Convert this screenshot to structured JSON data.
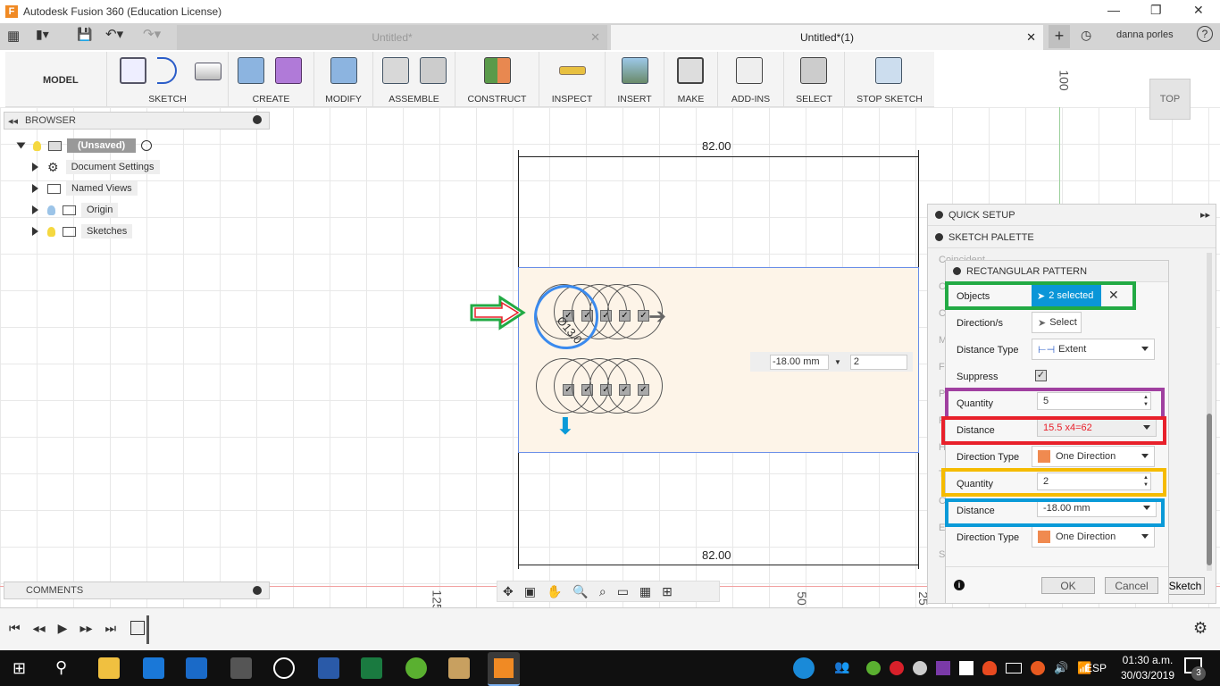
{
  "window": {
    "title": "Autodesk Fusion 360 (Education License)"
  },
  "tabs": [
    {
      "label": "Untitled*",
      "active": false
    },
    {
      "label": "Untitled*(1)",
      "active": true
    }
  ],
  "user": {
    "name": "danna porles"
  },
  "toolbar": {
    "workspace": "MODEL",
    "groups": [
      "SKETCH",
      "CREATE",
      "MODIFY",
      "ASSEMBLE",
      "CONSTRUCT",
      "INSPECT",
      "INSERT",
      "MAKE",
      "ADD-INS",
      "SELECT",
      "STOP SKETCH"
    ]
  },
  "browser": {
    "title": "BROWSER",
    "root": "(Unsaved)",
    "items": [
      "Document Settings",
      "Named Views",
      "Origin",
      "Sketches"
    ]
  },
  "comments": {
    "title": "COMMENTS"
  },
  "viewcube": {
    "label": "TOP"
  },
  "canvas": {
    "dim_top": "82.00",
    "dim_bottom": "82.00",
    "ruler_100": "100",
    "ruler_50": "50",
    "ruler_125": "125",
    "ruler_25": "25",
    "diameter": "Ø13.0",
    "inline_distance": "-18.00 mm",
    "inline_quantity": "2"
  },
  "palette": {
    "quick_setup": "QUICK SETUP",
    "sketch_palette": "SKETCH PALETTE",
    "faded": [
      "Coincident",
      "C",
      "C",
      "M",
      "Fi",
      "P",
      "P",
      "H",
      "T",
      "C",
      "Ec",
      "S"
    ],
    "title": "RECTANGULAR PATTERN",
    "objects_label": "Objects",
    "objects_value": "2 selected",
    "directions_label": "Direction/s",
    "directions_value": "Select",
    "distance_type_label": "Distance Type",
    "distance_type_value": "Extent",
    "suppress_label": "Suppress",
    "suppress_checked": true,
    "quantity1_label": "Quantity",
    "quantity1_value": "5",
    "distance1_label": "Distance",
    "distance1_value": "15.5 x4=62",
    "direction_type1_label": "Direction Type",
    "direction_type1_value": "One Direction",
    "quantity2_label": "Quantity",
    "quantity2_value": "2",
    "distance2_label": "Distance",
    "distance2_value": "-18.00 mm",
    "direction_type2_label": "Direction Type",
    "direction_type2_value": "One Direction",
    "ok": "OK",
    "cancel": "Cancel",
    "sketch": "Sketch"
  },
  "annotation_colors": {
    "objects": "#22aa44",
    "quantity1": "#a040a0",
    "distance1": "#e8202a",
    "quantity2": "#f5bb00",
    "distance2": "#0a9ad8"
  },
  "taskbar": {
    "time": "01:30 a.m.",
    "date": "30/03/2019",
    "lang": "ESP",
    "notifications": "3"
  }
}
